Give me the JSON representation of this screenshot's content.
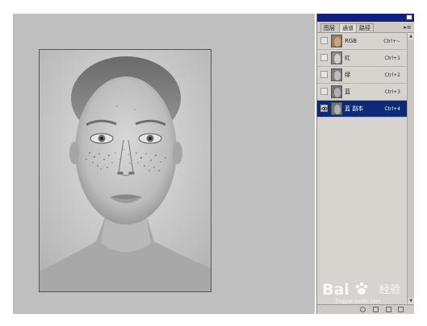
{
  "panel": {
    "tabs": [
      {
        "label": "图层"
      },
      {
        "label": "通道"
      },
      {
        "label": "路径"
      }
    ],
    "channels": [
      {
        "name": "RGB",
        "shortcut": "Ctrl+~",
        "visible": false
      },
      {
        "name": "红",
        "shortcut": "Ctrl+1",
        "visible": false
      },
      {
        "name": "绿",
        "shortcut": "Ctrl+2",
        "visible": false
      },
      {
        "name": "蓝",
        "shortcut": "Ctrl+3",
        "visible": false
      },
      {
        "name": "蓝 副本",
        "shortcut": "Ctrl+4",
        "visible": true,
        "selected": true
      }
    ]
  },
  "watermark": {
    "brand": "Bai",
    "brand_suffix": "经验",
    "url": "jingyan.baidu.com"
  },
  "colors": {
    "workspace": "#bfbfbf",
    "panel_bg": "#d7d3cf",
    "selection": "#0b2a78",
    "titlebar": "#11207a"
  }
}
